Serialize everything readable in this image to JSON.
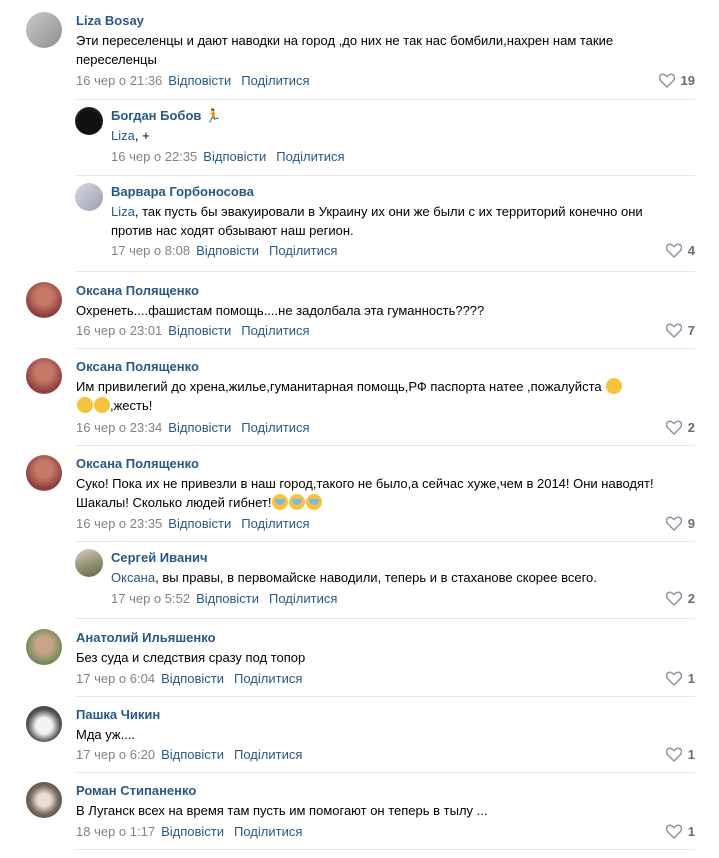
{
  "actions": {
    "reply": "Відповісти",
    "share": "Поділитися"
  },
  "comments": [
    {
      "author": "Liza Bosay",
      "text": "Эти переселенцы и дают наводки на город ,до них не так нас бомбили,нахрен нам такие переселенцы",
      "time": "16 чер о 21:36",
      "likes": "19"
    },
    {
      "author": "Богдан Бобов 🏃",
      "reply_to": "Liza",
      "text": ", +",
      "time": "16 чер о 22:35",
      "likes": ""
    },
    {
      "author": "Варвара Горбоносова",
      "reply_to": "Liza",
      "text": ", так пусть бы эвакуировали в Украину их они же были с их территорий конечно они против нас ходят обзывают наш регион.",
      "time": "17 чер о 8:08",
      "likes": "4"
    },
    {
      "author": "Оксана Полященко",
      "text": "Охренеть....фашистам помощь....не задолбала эта гуманность????",
      "time": "16 чер о 23:01",
      "likes": "7"
    },
    {
      "author": "Оксана Полященко",
      "text": "Им привилегий до хрена,жилье,гуманитарная помощь,РФ паспорта натее ,пожалуйста",
      "text2": ",жесть!",
      "time": "16 чер о 23:34",
      "likes": "2"
    },
    {
      "author": "Оксана Полященко",
      "text": "Суко! Пока их не привезли в наш город,такого не было,а сейчас хуже,чем в 2014! Они наводят! Шакалы! Сколько людей гибнет!",
      "time": "16 чер о 23:35",
      "likes": "9"
    },
    {
      "author": "Сергей Иванич",
      "reply_to": "Оксана",
      "text": ", вы правы, в первомайске наводили, теперь и в стаханове скорее всего.",
      "time": "17 чер о 5:52",
      "likes": "2"
    },
    {
      "author": "Анатолий Ильяшенко",
      "text": "Без суда и следствия сразу под топор",
      "time": "17 чер о 6:04",
      "likes": "1"
    },
    {
      "author": "Пашка Чикин",
      "text": "Мда уж....",
      "time": "17 чер о 6:20",
      "likes": "1"
    },
    {
      "author": "Роман Стипаненко",
      "text": "В Луганск всех на время там пусть им помогают он теперь в тылу ...",
      "time": "18 чер о 1:17",
      "likes": "1"
    }
  ],
  "colors": {
    "link": "#2a5885",
    "meta": "#828282",
    "separator": "#e7e8ec"
  }
}
